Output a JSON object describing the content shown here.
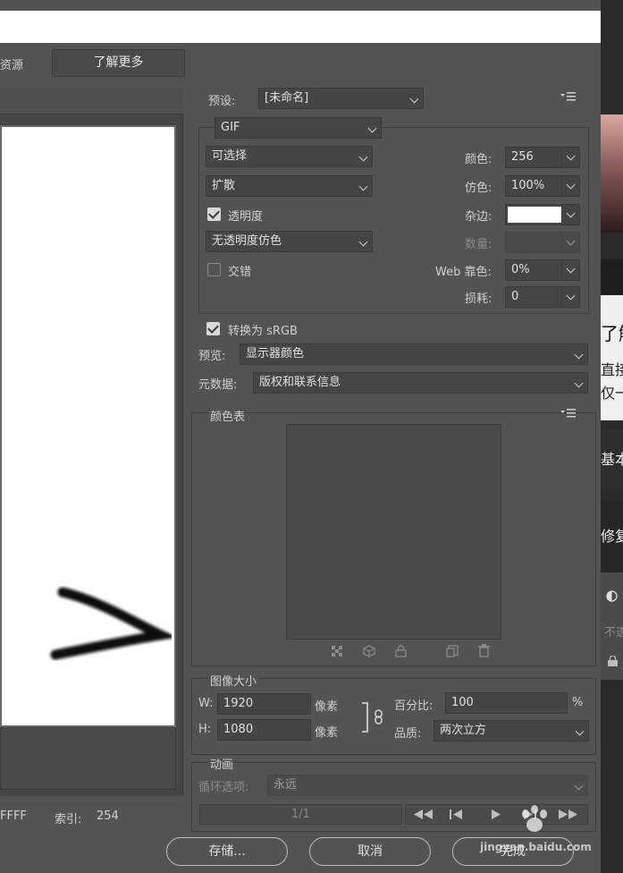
{
  "top": {
    "left_label": "资源",
    "learn_more": "了解更多"
  },
  "preset": {
    "label": "预设:",
    "value": "[未命名]"
  },
  "format": {
    "value": "GIF"
  },
  "left_opts": {
    "reduction": "可选择",
    "dither_algo": "扩散",
    "transparency_label": "透明度",
    "transparency_dither": "无透明度仿色",
    "interlace_label": "交错"
  },
  "right_opts": {
    "colors_label": "颜色:",
    "colors_value": "256",
    "dither_label": "仿色:",
    "dither_value": "100%",
    "matte_label": "杂边:",
    "amount_label": "数量:",
    "web_snap_label": "Web 靠色:",
    "web_snap_value": "0%",
    "lossy_label": "损耗:",
    "lossy_value": "0"
  },
  "convert_srgb": "转换为 sRGB",
  "preview": {
    "label": "预览:",
    "value": "显示器颜色"
  },
  "metadata": {
    "label": "元数据:",
    "value": "版权和联系信息"
  },
  "color_table": {
    "label": "颜色表"
  },
  "image_size": {
    "label": "图像大小",
    "w_label": "W:",
    "w_value": "1920",
    "w_unit": "像素",
    "h_label": "H:",
    "h_value": "1080",
    "h_unit": "像素",
    "percent_label": "百分比:",
    "percent_value": "100",
    "percent_sign": "%",
    "quality_label": "品质:",
    "quality_value": "两次立方"
  },
  "animation": {
    "label": "动画",
    "loop_label": "循环选项:",
    "loop_value": "永远",
    "frame": "1/1"
  },
  "status": {
    "hex_tail": "FFFF",
    "index_label": "索引:",
    "index_value": "254"
  },
  "buttons": {
    "save": "存储...",
    "cancel": "取消",
    "done": "完成"
  },
  "right_panel": {
    "t1": "了解",
    "t2": "直接",
    "t3": "仅一",
    "t4": "基本",
    "t5": "修复",
    "t6": "不透"
  },
  "watermark": "jingyan.baidu.com",
  "colors": {
    "bg": "#535353",
    "field": "#454545",
    "canvas": "#ffffff",
    "stroke": "#111111"
  }
}
